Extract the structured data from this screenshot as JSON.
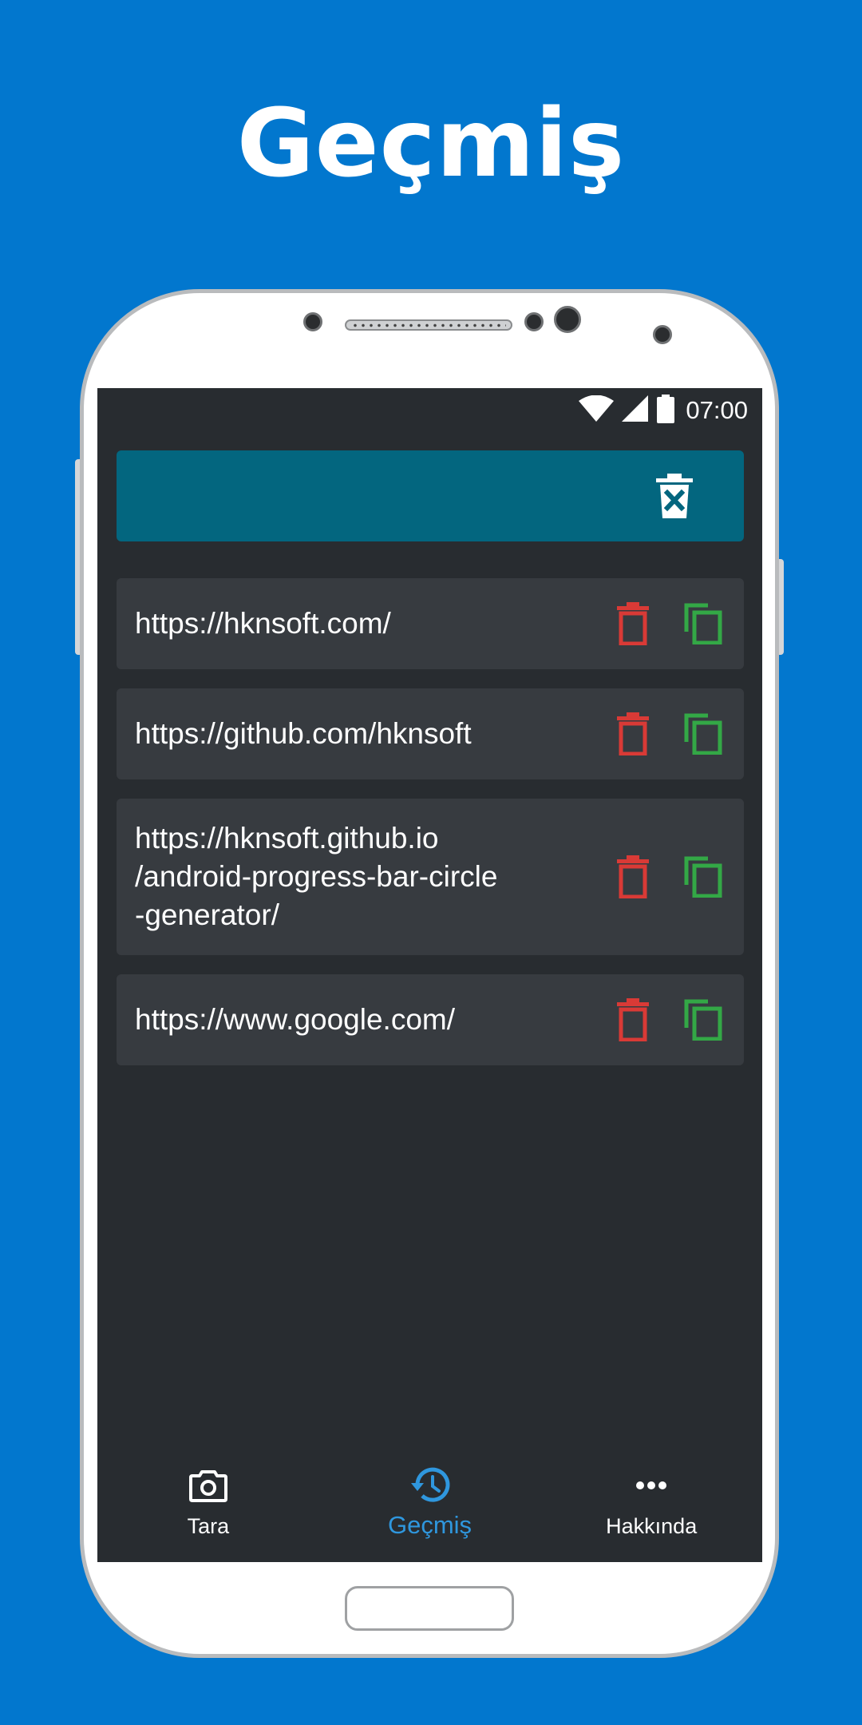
{
  "promo": {
    "title": "Geçmiş"
  },
  "status_bar": {
    "time": "07:00",
    "icons": [
      "wifi-icon",
      "signal-icon",
      "battery-icon"
    ]
  },
  "toolbar": {
    "clear_all_icon": "delete-all-icon",
    "background": "#03667f"
  },
  "history": {
    "items": [
      {
        "url": "https://hknsoft.com/"
      },
      {
        "url": "https://github.com/hknsoft"
      },
      {
        "url": "https://hknsoft.github.io\n/android-progress-bar-circle\n-generator/"
      },
      {
        "url": "https://www.google.com/"
      }
    ],
    "delete_icon": "trash-icon",
    "copy_icon": "copy-icon",
    "delete_color": "#d93a36",
    "copy_color": "#33a846"
  },
  "bottom_nav": {
    "items": [
      {
        "label": "Tara",
        "icon": "camera-icon",
        "active": false
      },
      {
        "label": "Geçmiş",
        "icon": "history-icon",
        "active": true
      },
      {
        "label": "Hakkında",
        "icon": "more-icon",
        "active": false
      }
    ],
    "active_color": "#2f97de"
  },
  "colors": {
    "page_background": "#0277CE",
    "screen_background": "#282c30",
    "card_background": "#373b40"
  }
}
